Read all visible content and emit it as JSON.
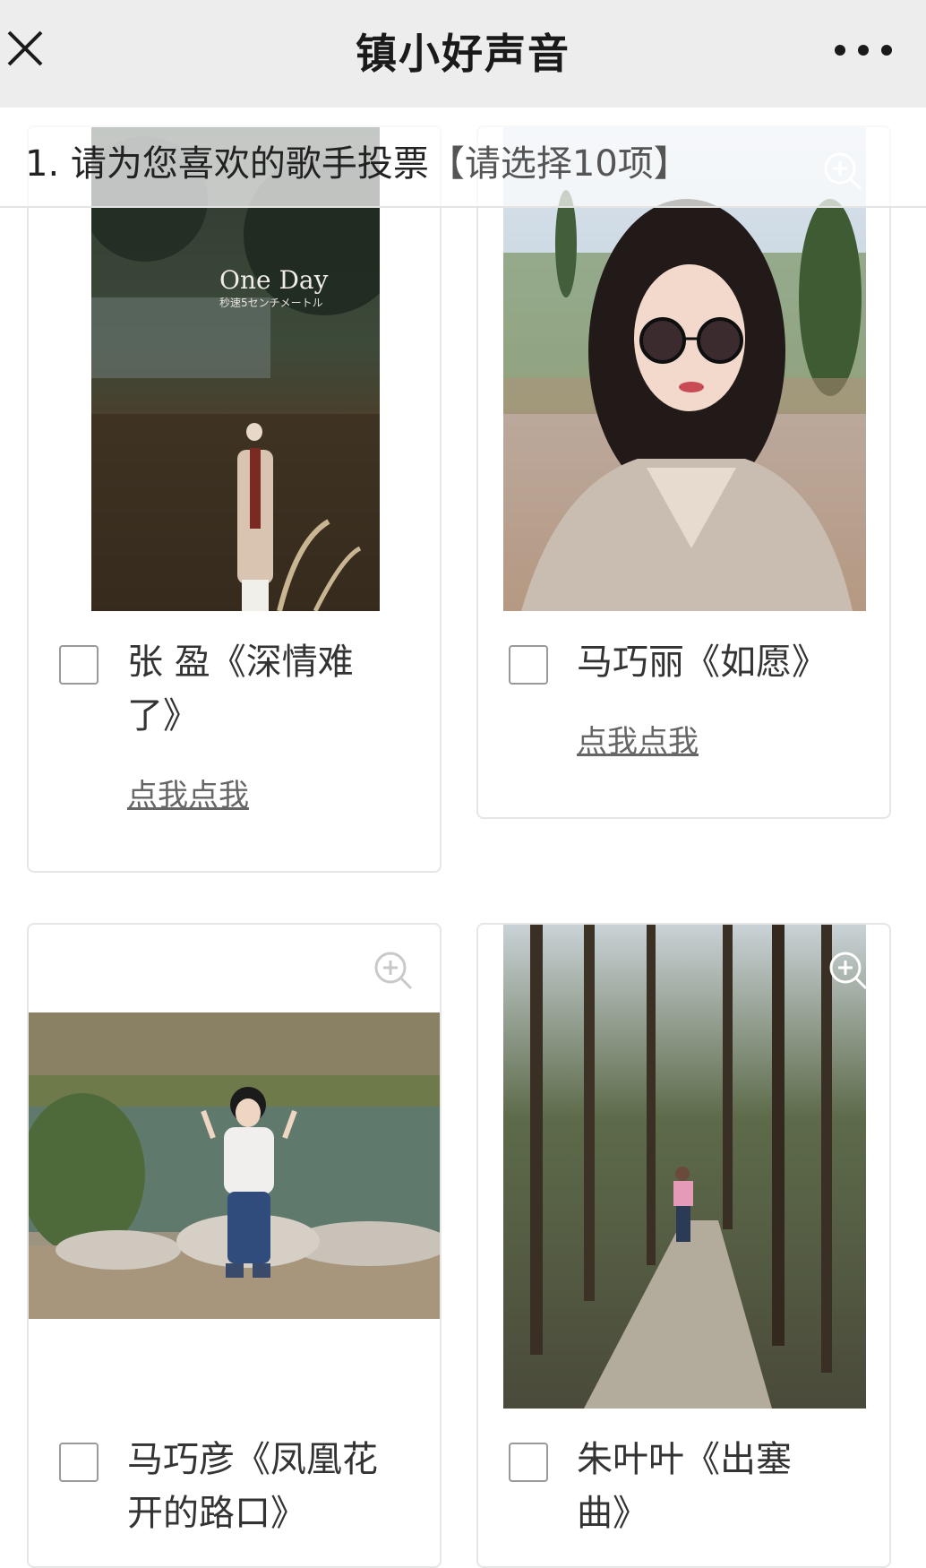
{
  "nav": {
    "title": "镇小好声音",
    "close_icon": "close-icon",
    "more_icon": "more-dots-icon"
  },
  "question": {
    "number": "1.",
    "text": "请为您喜欢的歌手投票",
    "hint": "【请选择10项】"
  },
  "photo_texts": {
    "one_day": "One Day",
    "one_day_sub": "秒速5センチメートル"
  },
  "options": [
    {
      "label_line1": "张 盈《深情难",
      "label_line2": "了》",
      "link": "点我点我"
    },
    {
      "label_line1": "马巧丽《如愿》",
      "link": "点我点我"
    },
    {
      "label_line1": "马巧彦《凤凰花",
      "label_line2": "开的路口》"
    },
    {
      "label_line1": "朱叶叶《出塞",
      "label_line2": "曲》"
    }
  ],
  "colors": {
    "navbar": "#ededed",
    "checkbox_border": "#999999",
    "card_border": "#e6e6e6"
  }
}
